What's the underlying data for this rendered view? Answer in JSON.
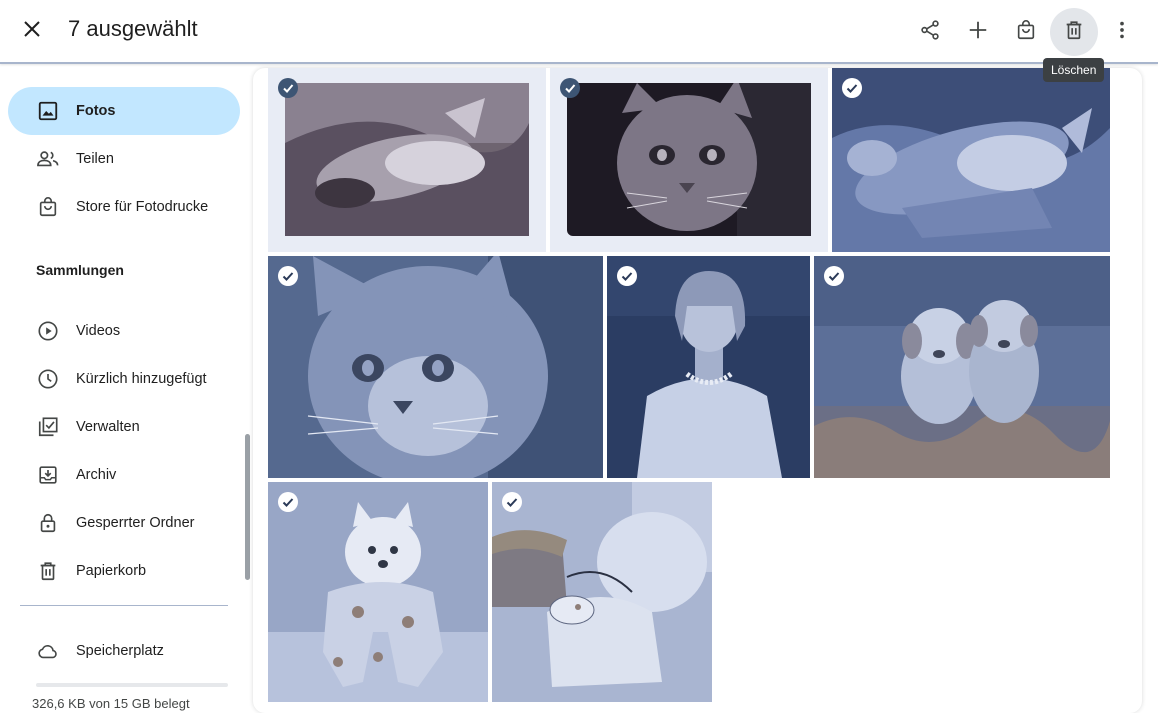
{
  "header": {
    "selection_title": "7 ausgewählt",
    "tooltip": "Löschen",
    "actions": [
      {
        "name": "share",
        "icon": "share-icon"
      },
      {
        "name": "add",
        "icon": "plus-icon"
      },
      {
        "name": "order-prints",
        "icon": "shopping-bag-icon"
      },
      {
        "name": "delete",
        "icon": "trash-icon"
      },
      {
        "name": "more",
        "icon": "more-vert-icon"
      }
    ]
  },
  "sidebar": {
    "items": [
      {
        "label": "Fotos",
        "icon": "photo-icon",
        "active": true
      },
      {
        "label": "Teilen",
        "icon": "people-icon"
      },
      {
        "label": "Store für Fotodrucke",
        "icon": "shopping-bag-icon"
      }
    ],
    "collections_heading": "Sammlungen",
    "collections": [
      {
        "label": "Videos",
        "icon": "play-circle-icon"
      },
      {
        "label": "Kürzlich hinzugefügt",
        "icon": "clock-icon"
      },
      {
        "label": "Verwalten",
        "icon": "checklist-icon"
      },
      {
        "label": "Archiv",
        "icon": "archive-icon"
      },
      {
        "label": "Gesperrter Ordner",
        "icon": "lock-icon"
      },
      {
        "label": "Papierkorb",
        "icon": "trash-icon"
      }
    ],
    "storage": {
      "label": "Speicherplatz",
      "icon": "cloud-icon",
      "usage_text": "326,6 KB von 15 GB belegt",
      "used_fraction": 0.0
    }
  },
  "photos": [
    {
      "subject": "cat lying on back",
      "selected": true
    },
    {
      "subject": "tabby cat face",
      "selected": true
    },
    {
      "subject": "cat stretching",
      "selected": true
    },
    {
      "subject": "tabby cat closeup",
      "selected": true
    },
    {
      "subject": "woman with pearl necklace",
      "selected": true
    },
    {
      "subject": "two golden retriever puppies",
      "selected": true
    },
    {
      "subject": "white pomeranian dog in outfit",
      "selected": true
    },
    {
      "subject": "dog with basket",
      "selected": true
    }
  ],
  "colors": {
    "accent": "#c2e7ff",
    "check_dark": "#3d5574",
    "divider": "#a8b5cc"
  }
}
